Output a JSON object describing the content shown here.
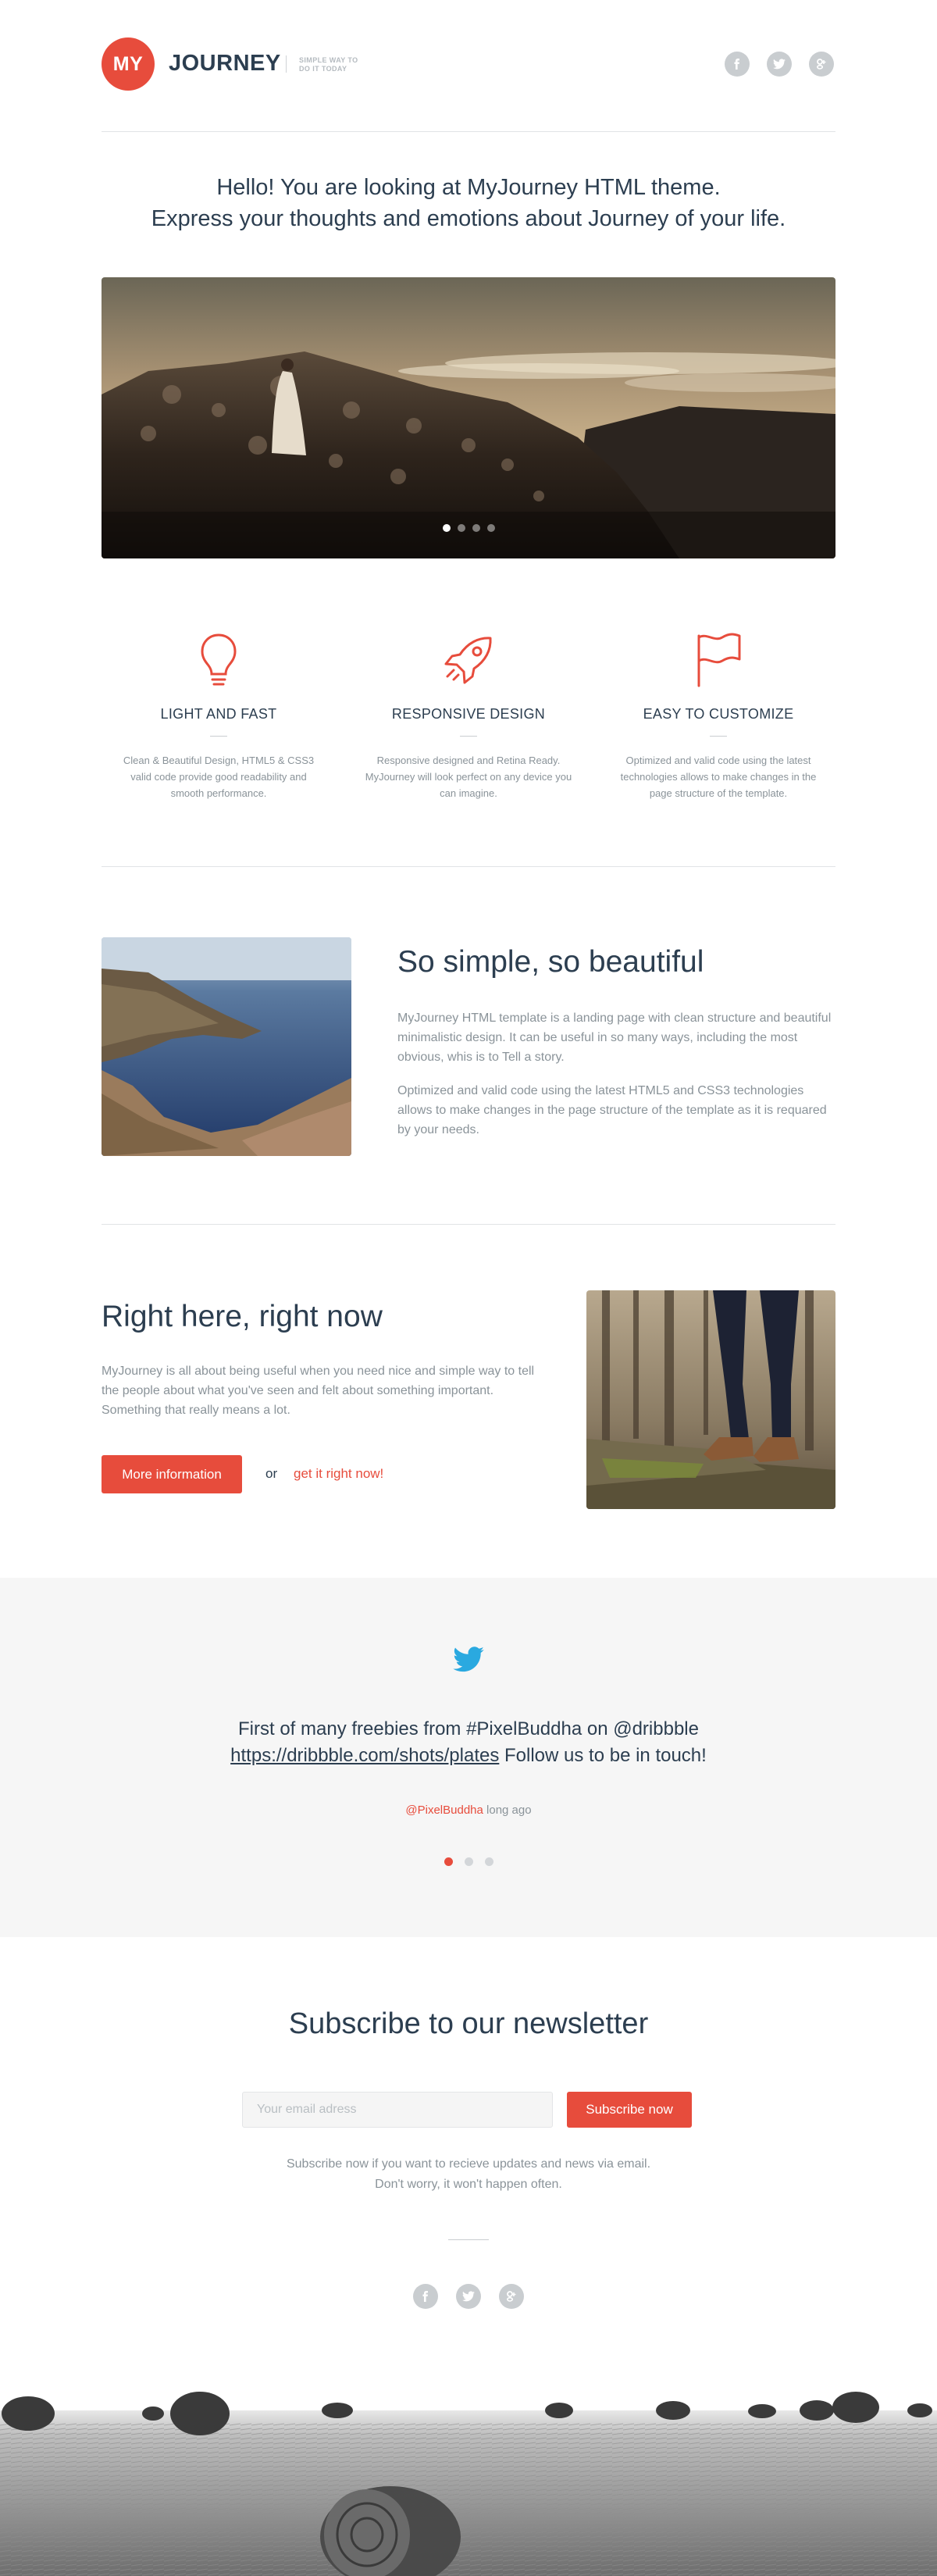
{
  "header": {
    "logo_badge": "MY",
    "logo_word": "JOURNEY",
    "tagline_line1": "SIMPLE WAY TO",
    "tagline_line2": "DO IT TODAY",
    "social": [
      "facebook-icon",
      "twitter-icon",
      "google-plus-icon"
    ]
  },
  "intro": {
    "line1": "Hello! You are looking at MyJourney HTML theme.",
    "line2": "Express your thoughts and emotions about Journey of your life."
  },
  "slider": {
    "slides": 4,
    "active": 1
  },
  "features": [
    {
      "icon": "lightbulb-icon",
      "title": "LIGHT AND FAST",
      "desc": "Clean & Beautiful Design, HTML5 & CSS3 valid code provide good readability and smooth performance."
    },
    {
      "icon": "rocket-icon",
      "title": "RESPONSIVE DESIGN",
      "desc": "Responsive designed and Retina Ready. MyJourney will look perfect on any device you can imagine."
    },
    {
      "icon": "flag-icon",
      "title": "EASY TO CUSTOMIZE",
      "desc": "Optimized and valid code using the latest technologies allows to make changes in the page structure of the template."
    }
  ],
  "simple": {
    "title": "So simple, so beautiful",
    "p1": "MyJourney HTML template is a landing page with clean structure and beautiful minimalistic design. It can be useful in so many ways, including the most obvious, whis is to Tell a story.",
    "p2": "Optimized and valid code using the latest HTML5 and CSS3 technologies allows to make changes in the page structure of the template as it is requared by your needs."
  },
  "rightnow": {
    "title": "Right here, right now",
    "p": "MyJourney is all about being useful when you need nice and simple way to tell the people about what you've seen and felt about something important. Something that really means a lot.",
    "button": "More information",
    "or": "or",
    "link": "get it right now!"
  },
  "tweet": {
    "line1": "First of many freebies from #PixelBuddha on @dribbble",
    "link": "https://dribbble.com/shots/plates",
    "line2_rest": " Follow us to be in touch!",
    "handle": "@PixelBuddha",
    "time": " long ago",
    "dots": 3,
    "active": 1
  },
  "newsletter": {
    "title": "Subscribe to our newsletter",
    "placeholder": "Your email adress",
    "button": "Subscribe now",
    "note1": "Subscribe now if you want to recieve updates and news via email.",
    "note2": "Don't worry, it won't happen often."
  },
  "colors": {
    "accent": "#e74c3c",
    "text": "#2c3e50",
    "muted": "#8a9399",
    "band": "#f6f6f6",
    "twitter": "#2aa9e0"
  }
}
